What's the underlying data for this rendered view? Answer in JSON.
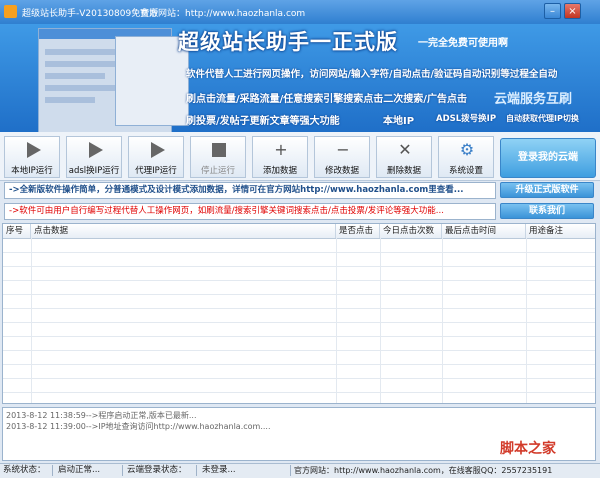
{
  "window": {
    "title": "超级站长助手-V20130809免费版",
    "site_label": "官方网站：http://www.haozhanla.com"
  },
  "banner": {
    "title": "超级站长助手一正式版",
    "subtitle": "一完全免费可使用啊",
    "line1": "软件代替人工进行网页操作，访问网站/输入字符/自动点击/验证码自动识别等过程全自动",
    "line2": "刷点击流量/采路流量/任意搜索引擎搜索点击二次搜索/广告点击",
    "line3": "刷投票/发帖子更新文章等强大功能",
    "tag1": "本地IP",
    "tag2": "ADSL拨号换IP",
    "tag3": "自动获取代理IP切换",
    "cloud": "云端服务互刷"
  },
  "toolbar": {
    "buttons": [
      {
        "label": "本地IP运行",
        "icon": "play-icon"
      },
      {
        "label": "adsl换IP运行",
        "icon": "play-icon"
      },
      {
        "label": "代理IP运行",
        "icon": "play-icon"
      },
      {
        "label": "停止运行",
        "icon": "stop-icon"
      },
      {
        "label": "添加数据",
        "icon": "plus-icon"
      },
      {
        "label": "修改数据",
        "icon": "minus-icon"
      },
      {
        "label": "删除数据",
        "icon": "close-icon"
      },
      {
        "label": "系统设置",
        "icon": "settings-icon"
      }
    ],
    "login_label": "登录我的云端"
  },
  "info": {
    "line1": "->全新版软件操作简单，分普通模式及设计模式添加数据，详情可在官方网站http://www.haozhanla.com里查看...",
    "line2": "->软件可由用户自行编写过程代替人工操作网页，如刷流量/搜索引擎关键词搜索点击/点击投票/发评论等强大功能...",
    "upgrade_label": "升级正式版软件",
    "contact_label": "联系我们"
  },
  "table": {
    "columns": [
      "序号",
      "点击数据",
      "是否点击",
      "今日点击次数",
      "最后点击时间",
      "用途备注"
    ]
  },
  "log": {
    "lines": [
      "2013-8-12 11:38:59-->程序启动正常,版本已最新...",
      "2013-8-12 11:39:00-->IP地址查询访问http://www.haozhanla.com...."
    ]
  },
  "watermark": "脚本之家",
  "status": {
    "sys_label": "系统状态：",
    "sys_value": "启动正常...",
    "cloud_label": "云端登录状态：",
    "cloud_value": "未登录...",
    "site": "官方网站：http://www.haozhanla.com，在线客服QQ：2557235191"
  }
}
